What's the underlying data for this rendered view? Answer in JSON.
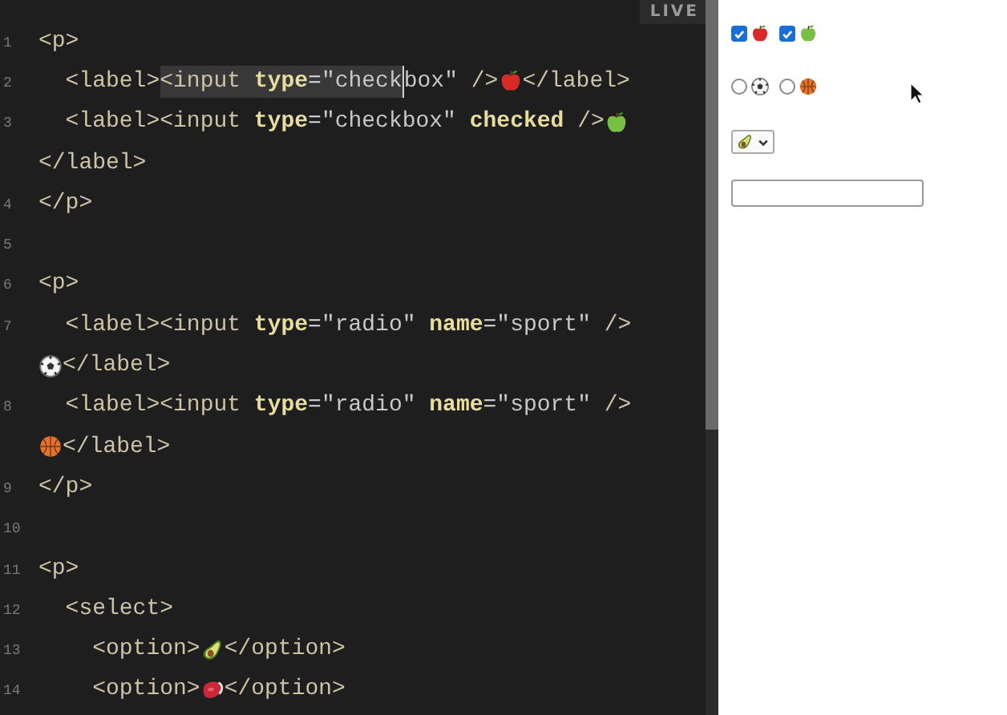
{
  "editor": {
    "badge": "LIVE",
    "lines": [
      {
        "number": "1",
        "tokens": [
          {
            "kind": "tag",
            "text": "<p>"
          }
        ]
      },
      {
        "number": "2",
        "tokens": [
          {
            "kind": "tag",
            "text": "  <label>",
            "highlighted": false
          },
          {
            "kind": "tag",
            "text": "<input ",
            "highlighted": true
          },
          {
            "kind": "attr",
            "text": "type",
            "highlighted": true
          },
          {
            "kind": "punct",
            "text": "=",
            "highlighted": true
          },
          {
            "kind": "str",
            "text": "\"check",
            "highlighted": true
          },
          {
            "kind": "str",
            "text": "box\" ",
            "highlighted": false
          },
          {
            "kind": "tag",
            "text": "/>",
            "highlighted": false
          },
          {
            "kind": "icon",
            "highlighted": false
          },
          {
            "kind": "tag",
            "text": "</label>",
            "highlighted": false
          }
        ]
      },
      {
        "number": "3",
        "tokens": [
          {
            "kind": "tag",
            "text": "  <label><input "
          },
          {
            "kind": "attr",
            "text": "type"
          },
          {
            "kind": "punct",
            "text": "="
          },
          {
            "kind": "str",
            "text": "\"checkbox\" "
          },
          {
            "kind": "attr",
            "text": "checked"
          },
          {
            "kind": "tag",
            "text": " />"
          },
          {
            "kind": "icon"
          }
        ]
      },
      {
        "tokens": [
          {
            "kind": "tag",
            "text": "</label>"
          }
        ]
      },
      {
        "number": "4",
        "tokens": [
          {
            "kind": "tag",
            "text": "</p>"
          }
        ]
      },
      {
        "number": "5"
      },
      {
        "number": "6",
        "tokens": [
          {
            "kind": "tag",
            "text": "<p>"
          }
        ]
      },
      {
        "number": "7",
        "tokens": [
          {
            "kind": "tag",
            "text": "  <label><input "
          },
          {
            "kind": "attr",
            "text": "type"
          },
          {
            "kind": "punct",
            "text": "="
          },
          {
            "kind": "str",
            "text": "\"radio\" "
          },
          {
            "kind": "attr",
            "text": "name"
          },
          {
            "kind": "punct",
            "text": "="
          },
          {
            "kind": "str",
            "text": "\"sport\" "
          },
          {
            "kind": "tag",
            "text": "/>"
          }
        ]
      },
      {
        "tokens": [
          {
            "kind": "icon"
          },
          {
            "kind": "tag",
            "text": "</label>"
          }
        ]
      },
      {
        "number": "8",
        "tokens": [
          {
            "kind": "tag",
            "text": "  <label><input "
          },
          {
            "kind": "attr",
            "text": "type"
          },
          {
            "kind": "punct",
            "text": "="
          },
          {
            "kind": "str",
            "text": "\"radio\" "
          },
          {
            "kind": "attr",
            "text": "name"
          },
          {
            "kind": "punct",
            "text": "="
          },
          {
            "kind": "str",
            "text": "\"sport\" "
          },
          {
            "kind": "tag",
            "text": "/>"
          }
        ]
      },
      {
        "tokens": [
          {
            "kind": "icon"
          },
          {
            "kind": "tag",
            "text": "</label>"
          }
        ]
      },
      {
        "number": "9",
        "tokens": [
          {
            "kind": "tag",
            "text": "</p>"
          }
        ]
      },
      {
        "number": "10"
      },
      {
        "number": "11",
        "tokens": [
          {
            "kind": "tag",
            "text": "<p>"
          }
        ]
      },
      {
        "number": "12",
        "tokens": [
          {
            "kind": "tag",
            "text": "  <select>"
          }
        ]
      },
      {
        "number": "13",
        "tokens": [
          {
            "kind": "tag",
            "text": "    <option>"
          },
          {
            "kind": "icon"
          },
          {
            "kind": "tag",
            "text": "</option>"
          }
        ]
      },
      {
        "number": "14",
        "tokens": [
          {
            "kind": "tag",
            "text": "    <option>"
          },
          {
            "kind": "icon"
          },
          {
            "kind": "tag",
            "text": "</option>"
          }
        ]
      }
    ]
  },
  "preview": {
    "rows": [
      {
        "kind": "checkboxes",
        "items": [
          {
            "checked": true
          },
          {
            "checked": true
          }
        ]
      },
      {
        "kind": "radios",
        "items": [
          {
            "selected": false
          },
          {
            "selected": false
          }
        ]
      },
      {
        "kind": "select"
      },
      {
        "kind": "text_field"
      }
    ]
  }
}
